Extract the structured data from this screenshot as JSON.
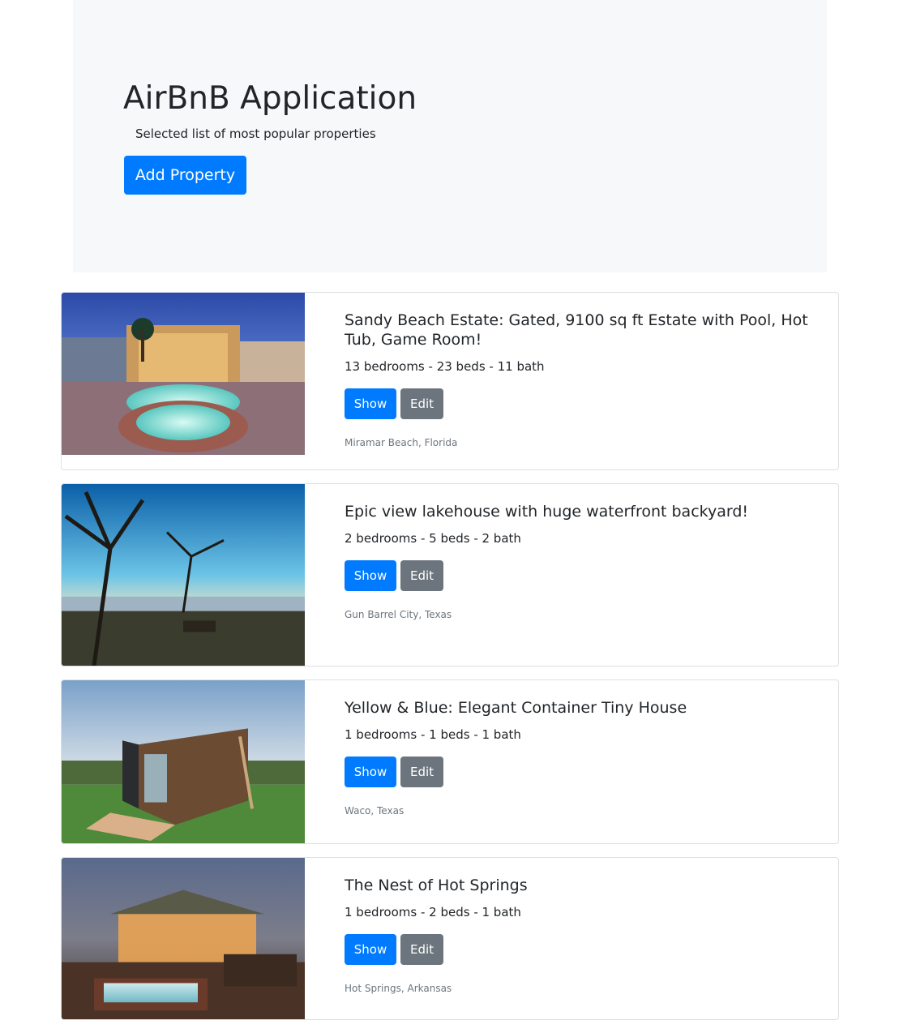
{
  "jumbotron": {
    "title": "AirBnB Application",
    "subtitle": "Selected list of most popular properties",
    "add_button": "Add Property"
  },
  "properties": [
    {
      "title": "Sandy Beach Estate: Gated, 9100 sq ft Estate with Pool, Hot Tub, Game Room!",
      "details": "13 bedrooms - 23 beds - 11 bath",
      "show_label": "Show",
      "edit_label": "Edit",
      "location": "Miramar Beach, Florida"
    },
    {
      "title": "Epic view lakehouse with huge waterfront backyard!",
      "details": "2 bedrooms - 5 beds - 2 bath",
      "show_label": "Show",
      "edit_label": "Edit",
      "location": "Gun Barrel City, Texas"
    },
    {
      "title": "Yellow & Blue: Elegant Container Tiny House",
      "details": "1 bedrooms - 1 beds - 1 bath",
      "show_label": "Show",
      "edit_label": "Edit",
      "location": "Waco, Texas"
    },
    {
      "title": "The Nest of Hot Springs",
      "details": "1 bedrooms - 2 beds - 1 bath",
      "show_label": "Show",
      "edit_label": "Edit",
      "location": "Hot Springs, Arkansas"
    }
  ],
  "colors": {
    "primary": "#007bff",
    "secondary": "#6c757d",
    "jumbotron_bg": "#f7f8f9"
  }
}
